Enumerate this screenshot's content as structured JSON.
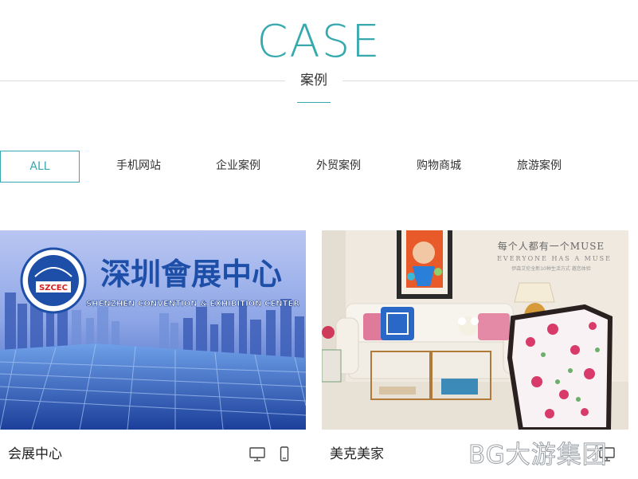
{
  "header": {
    "title": "CASE",
    "subtitle": "案例"
  },
  "tabs": [
    {
      "label": "ALL",
      "active": true
    },
    {
      "label": "手机网站",
      "active": false
    },
    {
      "label": "企业案例",
      "active": false
    },
    {
      "label": "外贸案例",
      "active": false
    },
    {
      "label": "购物商城",
      "active": false
    },
    {
      "label": "旅游案例",
      "active": false
    }
  ],
  "cards": [
    {
      "caption": "会展中心",
      "image": {
        "logo_text": "SZCEC",
        "headline": "深圳會展中心",
        "tagline": "SHENZHEN CONVENTION & EXHIBITION CENTER"
      },
      "icons": [
        "desktop-icon",
        "mobile-icon"
      ]
    },
    {
      "caption": "美克美家",
      "image": {
        "headline": "每个人都有一个MUSE",
        "tagline": "EVERYONE HAS A MUSE",
        "small_text": "伊森艾伦全新10种生活方式 邀您体验"
      },
      "icons": [
        "desktop-icon"
      ]
    }
  ],
  "watermark": "BG大游集团",
  "colors": {
    "accent": "#35a9ae",
    "text": "#333333",
    "rule": "#dcdcdc"
  }
}
